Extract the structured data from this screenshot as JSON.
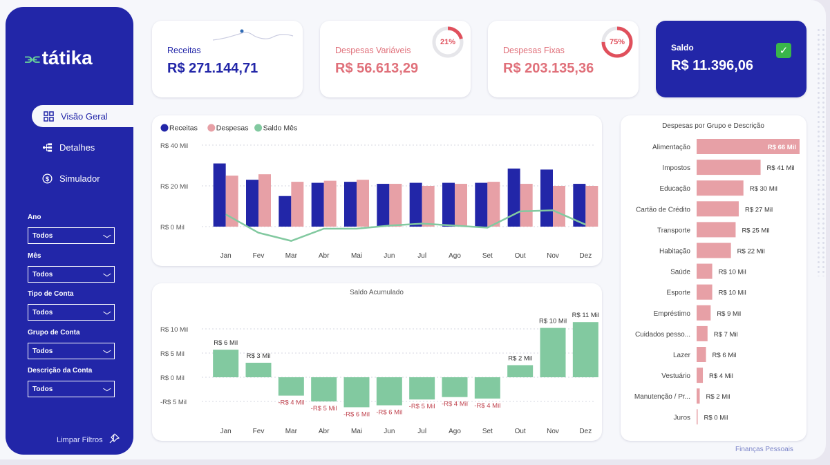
{
  "app": {
    "brand": "tátika",
    "footer": "Finanças Pessoais"
  },
  "colors": {
    "navy": "#2226a8",
    "pink": "#e7a0a6",
    "green": "#82c9a0",
    "red": "#e0707a"
  },
  "nav": [
    {
      "label": "Visão Geral",
      "icon": "dashboard-grid-icon",
      "active": true
    },
    {
      "label": "Detalhes",
      "icon": "hierarchy-icon",
      "active": false
    },
    {
      "label": "Simulador",
      "icon": "dollar-circle-icon",
      "active": false
    }
  ],
  "filters": [
    {
      "label": "Ano",
      "value": "Todos"
    },
    {
      "label": "Mês",
      "value": "Todos"
    },
    {
      "label": "Tipo de Conta",
      "value": "Todos"
    },
    {
      "label": "Grupo de Conta",
      "value": "Todos"
    },
    {
      "label": "Descrição da Conta",
      "value": "Todos"
    }
  ],
  "clear_filters": "Limpar Filtros",
  "kpis": {
    "receitas": {
      "label": "Receitas",
      "value": "R$ 271.144,71"
    },
    "variaveis": {
      "label": "Despesas Variáveis",
      "value": "R$ 56.613,29",
      "pct": "21%",
      "pct_value": 0.21
    },
    "fixas": {
      "label": "Despesas Fixas",
      "value": "R$ 203.135,36",
      "pct": "75%",
      "pct_value": 0.75
    },
    "saldo": {
      "label": "Saldo",
      "value": "R$ 11.396,06",
      "icon": "check-icon"
    }
  },
  "chart_data": [
    {
      "type": "bar",
      "title": "",
      "legend": [
        "Receitas",
        "Despesas",
        "Saldo Mês"
      ],
      "categories": [
        "Jan",
        "Fev",
        "Mar",
        "Abr",
        "Mai",
        "Jun",
        "Jul",
        "Ago",
        "Set",
        "Out",
        "Nov",
        "Dez"
      ],
      "y_ticks": [
        "R$ 40 Mil",
        "R$ 20 Mil",
        "R$ 0 Mil"
      ],
      "ylim": [
        -8,
        40
      ],
      "series": [
        {
          "name": "Receitas",
          "type": "bar",
          "values": [
            31,
            23,
            15,
            21.5,
            22,
            21,
            21.5,
            21.5,
            21.5,
            28.5,
            28,
            21
          ]
        },
        {
          "name": "Despesas",
          "type": "bar",
          "values": [
            25,
            25.7,
            22,
            22.5,
            23,
            21,
            20,
            21,
            22,
            21,
            20,
            20
          ]
        },
        {
          "name": "Saldo Mês",
          "type": "line",
          "values": [
            6,
            -3,
            -7,
            -1,
            -1,
            0.5,
            1.5,
            0.5,
            -0.5,
            7.5,
            8,
            1
          ]
        }
      ]
    },
    {
      "type": "bar",
      "title": "Saldo Acumulado",
      "categories": [
        "Jan",
        "Fev",
        "Mar",
        "Abr",
        "Mai",
        "Jun",
        "Jul",
        "Ago",
        "Set",
        "Out",
        "Nov",
        "Dez"
      ],
      "y_ticks": [
        "R$ 10 Mil",
        "R$ 5 Mil",
        "R$ 0 Mil",
        "-R$ 5 Mil"
      ],
      "ylim": [
        -5,
        10
      ],
      "values": [
        5.7,
        3.0,
        -3.8,
        -5.0,
        -6.2,
        -5.8,
        -4.6,
        -4.1,
        -4.4,
        2.5,
        10.2,
        11.4
      ],
      "labels": [
        "R$ 6 Mil",
        "R$ 3 Mil",
        "-R$ 4 Mil",
        "-R$ 5 Mil",
        "-R$ 6 Mil",
        "-R$ 6 Mil",
        "-R$ 5 Mil",
        "-R$ 4 Mil",
        "-R$ 4 Mil",
        "R$ 2 Mil",
        "R$ 10 Mil",
        "R$ 11 Mil"
      ]
    },
    {
      "type": "bar",
      "orientation": "horizontal",
      "title": "Despesas por Grupo e Descrição",
      "categories": [
        "Alimentação",
        "Impostos",
        "Educação",
        "Cartão de Crédito",
        "Transporte",
        "Habitação",
        "Saúde",
        "Esporte",
        "Empréstimo",
        "Cuidados pesso...",
        "Lazer",
        "Vestuário",
        "Manutenção / Pr...",
        "Juros"
      ],
      "values": [
        66,
        41,
        30,
        27,
        25,
        22,
        10,
        10,
        9,
        7,
        6,
        4,
        2,
        0
      ],
      "labels": [
        "R$ 66 Mil",
        "R$ 41 Mil",
        "R$ 30 Mil",
        "R$ 27 Mil",
        "R$ 25 Mil",
        "R$ 22 Mil",
        "R$ 10 Mil",
        "R$ 10 Mil",
        "R$ 9 Mil",
        "R$ 7 Mil",
        "R$ 6 Mil",
        "R$ 4 Mil",
        "R$ 2 Mil",
        "R$ 0 Mil"
      ]
    }
  ]
}
